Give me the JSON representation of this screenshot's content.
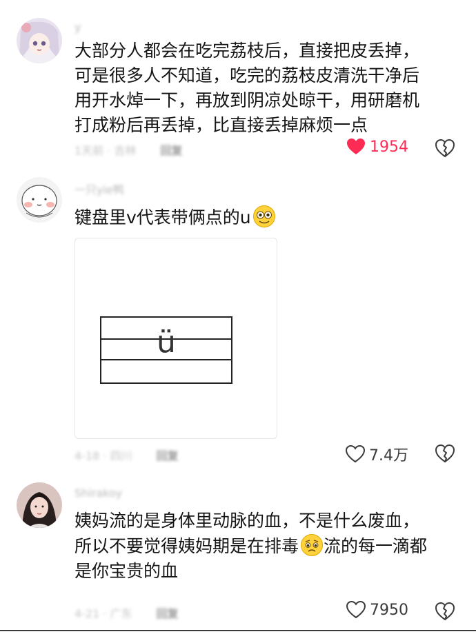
{
  "comments": [
    {
      "username": "y",
      "lines": [
        "大部分人都会在吃完荔枝后，直接把皮丢掉，",
        "可是很多人不知道，吃完的荔枝皮清洗干净后",
        "用开水焯一下，再放到阴凉处晾干，用研磨机",
        "打成粉后再丢掉，比直接丢掉麻烦一点"
      ],
      "meta": "1天前 · 吉林",
      "reply_label": "回复",
      "likes": "1954",
      "liked": true
    },
    {
      "username": "一只yie鸭",
      "text": "键盘里v代表带俩点的u",
      "meta": "4-18 · 四川",
      "reply_label": "回复",
      "likes": "7.4万",
      "liked": false,
      "image": {
        "glyph": "ü"
      }
    },
    {
      "username": "Shirakoy",
      "lines_a": [
        "姨妈流的是身体里动脉的血，不是什么废血，"
      ],
      "line_b1": "所以不要觉得姨妈期是在排毒",
      "line_b2": "流的每一滴都",
      "line_c": "是你宝贵的血",
      "meta": "4-21 · 广东",
      "reply_label": "回复",
      "likes": "7950",
      "liked": false
    }
  ],
  "colors": {
    "like_active": "#fe2c55",
    "meta": "#c4c4c4",
    "text": "#151515"
  },
  "icons": [
    "avatar-anime-girl",
    "avatar-cartoon-face",
    "avatar-woman-photo",
    "heart-filled-icon",
    "heart-outline-icon",
    "broken-heart-icon",
    "smiling-emoji-icon",
    "worried-emoji-icon"
  ]
}
